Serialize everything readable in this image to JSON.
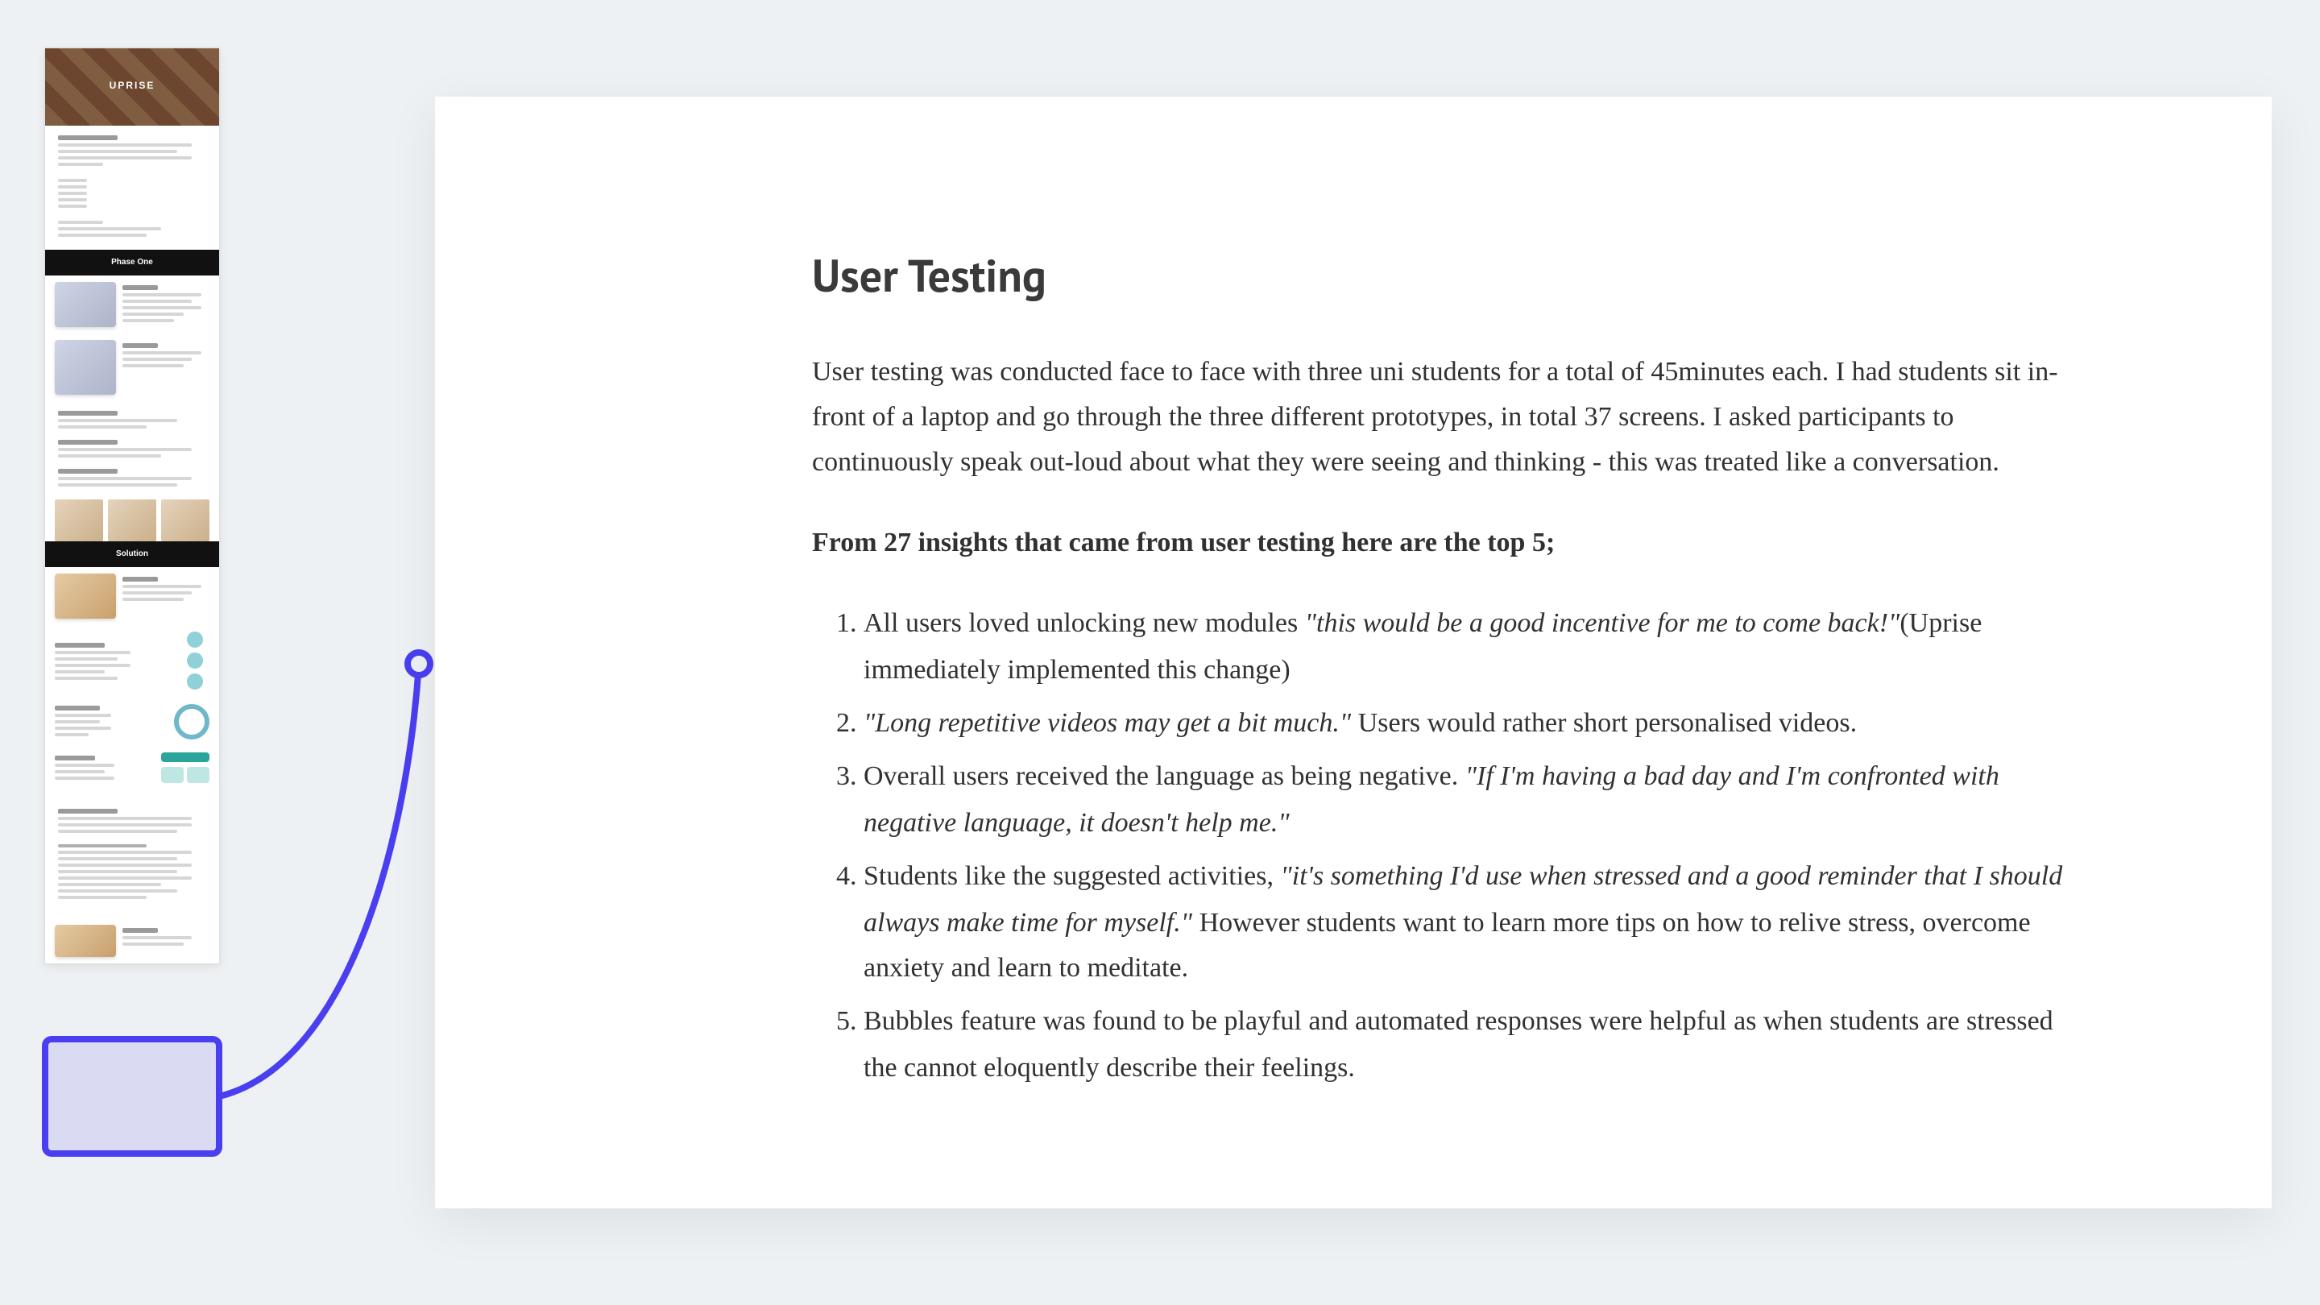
{
  "minimap": {
    "brand": "UPRISE",
    "phase_label": "Phase One",
    "solution_label": "Solution"
  },
  "article": {
    "heading": "User Testing",
    "intro": "User testing was conducted face to face with three uni students for a total of 45minutes each. I had students sit in-front of a laptop and go through the three different prototypes, in total 37 screens. I asked participants to continuously speak out-loud about what they were seeing and thinking - this was treated like a conversation.",
    "lead": "From 27 insights that came from user testing here are the top 5;",
    "insights": [
      {
        "pre": "All users loved unlocking new modules ",
        "quote": "\"this would be a good incentive for me to come back!\"",
        "post": "(Uprise immediately implemented this change)"
      },
      {
        "pre": "",
        "quote": "\"Long repetitive videos may get a bit much.\"",
        "post": " Users would rather short personalised videos."
      },
      {
        "pre": "Overall users received the language as being negative. ",
        "quote": "\"If I'm having a bad day and I'm confronted with negative language, it doesn't help me.\"",
        "post": ""
      },
      {
        "pre": "Students like the suggested activities, ",
        "quote": "\"it's something I'd use when stressed and a good reminder that I should always make time for myself.\"",
        "post": " However students want to learn more tips on how to relive stress, overcome anxiety and learn to meditate."
      },
      {
        "pre": "Bubbles feature was found to be playful and automated responses were helpful as when students are stressed the cannot eloquently describe their feelings.",
        "quote": "",
        "post": ""
      }
    ]
  },
  "colors": {
    "accent": "#4a3ff0"
  }
}
